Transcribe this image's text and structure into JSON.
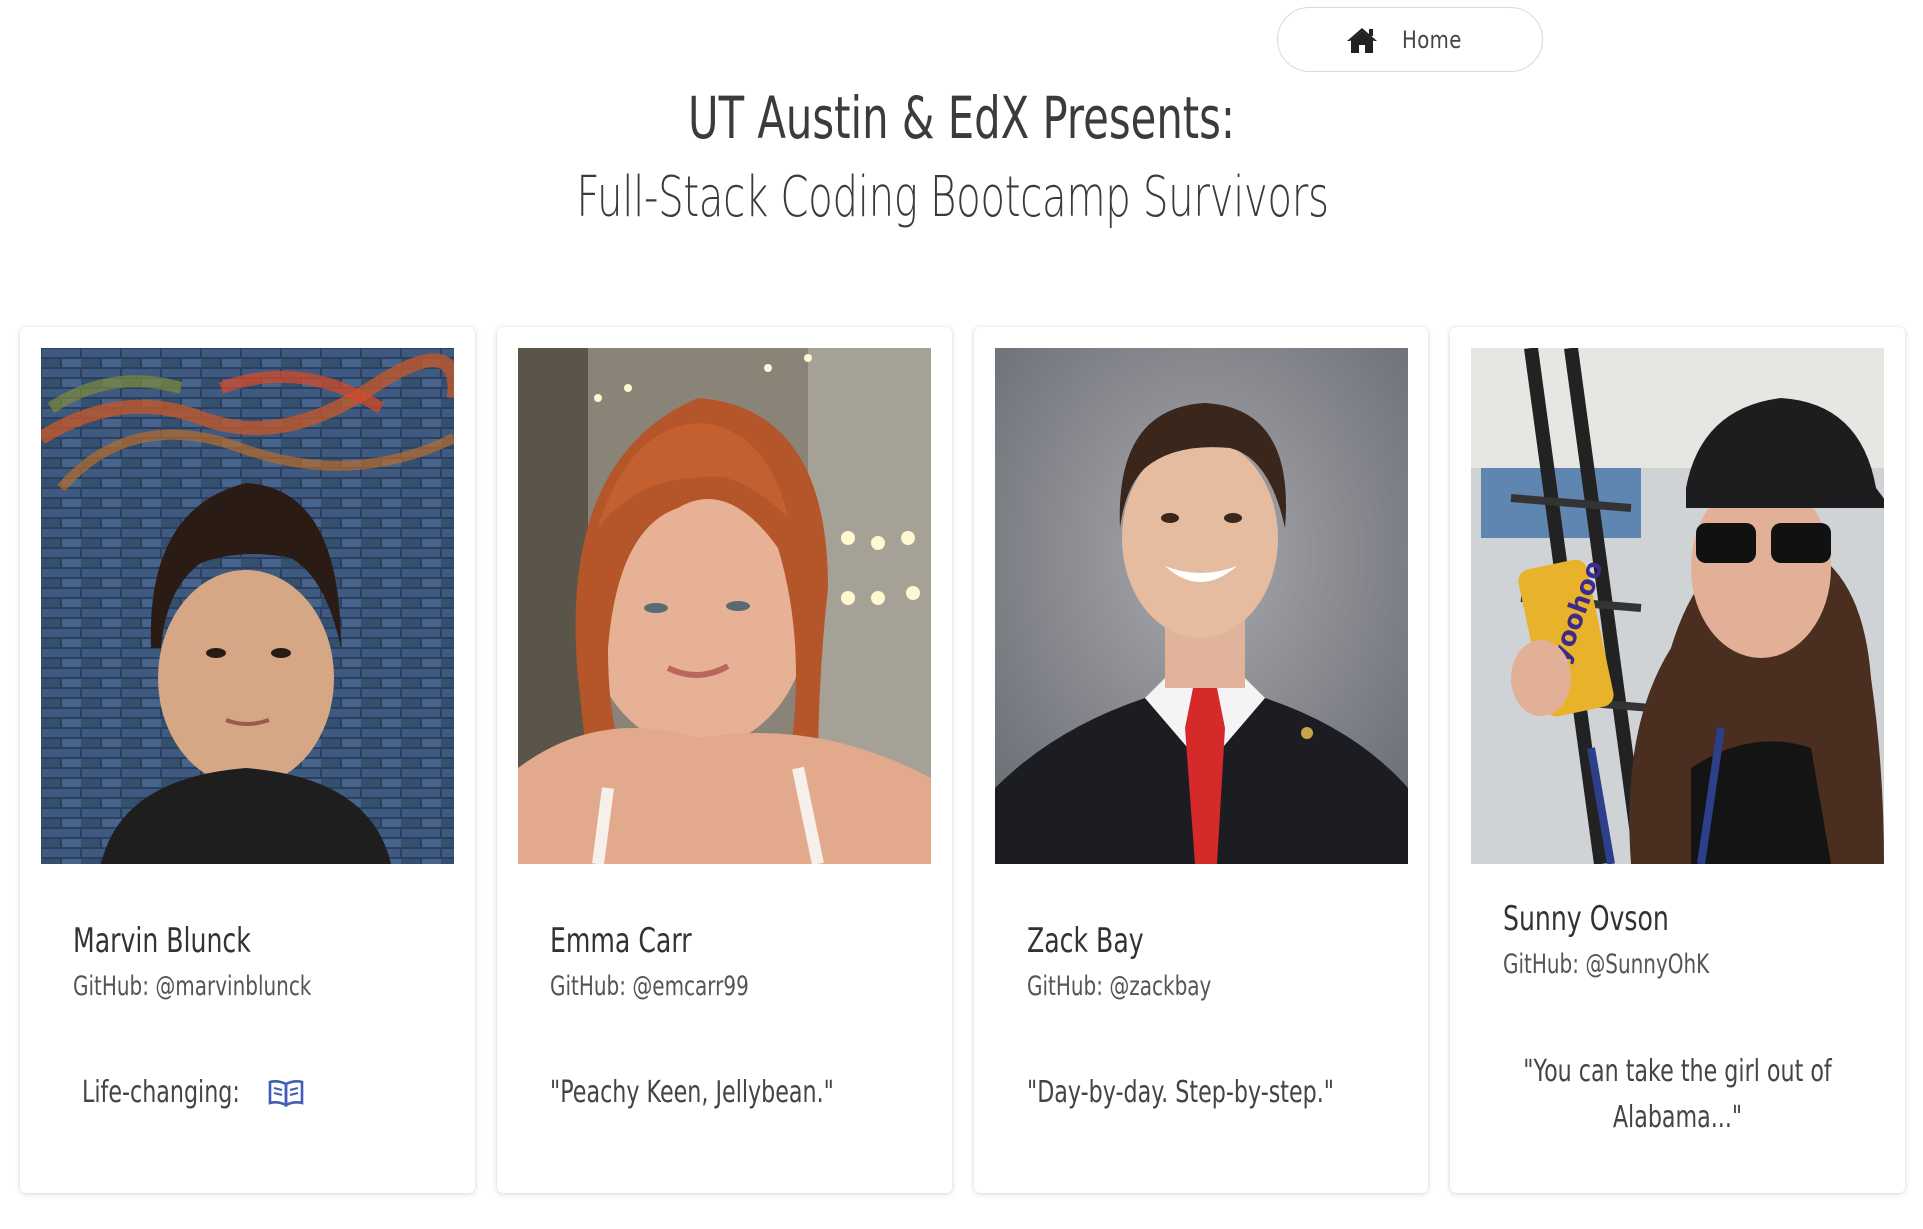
{
  "nav": {
    "home_label": "Home",
    "home_icon": "home-icon"
  },
  "header": {
    "title": "UT Austin & EdX Presents:",
    "subtitle": "Full-Stack Coding Bootcamp Survivors"
  },
  "colors": {
    "text": "#3b3b3b",
    "icon_accent": "#3f5db8",
    "card_background": "#ffffff"
  },
  "cards": [
    {
      "name": "Marvin Blunck",
      "github": "GitHub: @marvinblunck",
      "quote": "Life-changing:",
      "quote_icon": "book-icon"
    },
    {
      "name": "Emma Carr",
      "github": "GitHub: @emcarr99",
      "quote": "\"Peachy Keen, Jellybean.\""
    },
    {
      "name": "Zack Bay",
      "github": "GitHub: @zackbay",
      "quote": "\"Day-by-day. Step-by-step.\""
    },
    {
      "name": "Sunny Ovson",
      "github": "GitHub: @SunnyOhK",
      "quote_line1": "\"You can take the girl out of",
      "quote_line2": "Alabama...\""
    }
  ]
}
